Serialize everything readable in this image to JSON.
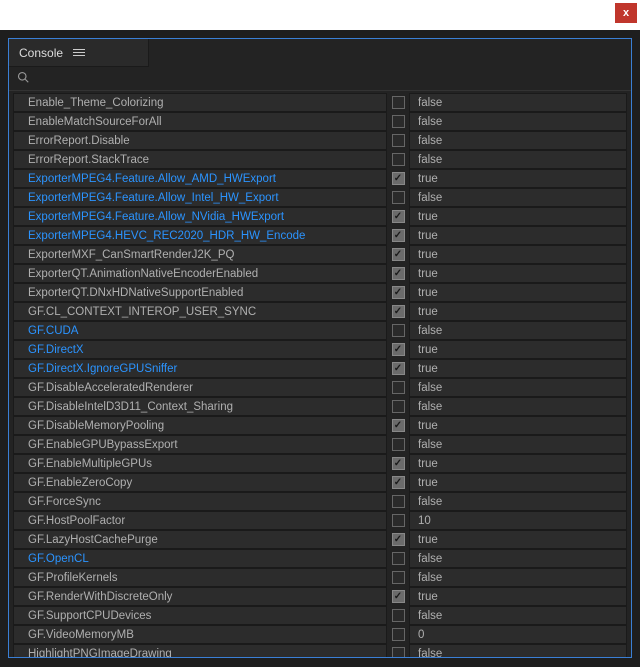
{
  "titlebar": {
    "close_label": "x"
  },
  "panel": {
    "title": "Console",
    "search_placeholder": ""
  },
  "rows": [
    {
      "name": "Enable_Theme_Colorizing",
      "checked": false,
      "value": "false",
      "highlight": false
    },
    {
      "name": "EnableMatchSourceForAll",
      "checked": false,
      "value": "false",
      "highlight": false
    },
    {
      "name": "ErrorReport.Disable",
      "checked": false,
      "value": "false",
      "highlight": false
    },
    {
      "name": "ErrorReport.StackTrace",
      "checked": false,
      "value": "false",
      "highlight": false
    },
    {
      "name": "ExporterMPEG4.Feature.Allow_AMD_HWExport",
      "checked": true,
      "value": "true",
      "highlight": true
    },
    {
      "name": "ExporterMPEG4.Feature.Allow_Intel_HW_Export",
      "checked": false,
      "value": "false",
      "highlight": true
    },
    {
      "name": "ExporterMPEG4.Feature.Allow_NVidia_HWExport",
      "checked": true,
      "value": "true",
      "highlight": true
    },
    {
      "name": "ExporterMPEG4.HEVC_REC2020_HDR_HW_Encode",
      "checked": true,
      "value": "true",
      "highlight": true
    },
    {
      "name": "ExporterMXF_CanSmartRenderJ2K_PQ",
      "checked": true,
      "value": "true",
      "highlight": false
    },
    {
      "name": "ExporterQT.AnimationNativeEncoderEnabled",
      "checked": true,
      "value": "true",
      "highlight": false
    },
    {
      "name": "ExporterQT.DNxHDNativeSupportEnabled",
      "checked": true,
      "value": "true",
      "highlight": false
    },
    {
      "name": "GF.CL_CONTEXT_INTEROP_USER_SYNC",
      "checked": true,
      "value": "true",
      "highlight": false
    },
    {
      "name": "GF.CUDA",
      "checked": false,
      "value": "false",
      "highlight": true
    },
    {
      "name": "GF.DirectX",
      "checked": true,
      "value": "true",
      "highlight": true
    },
    {
      "name": "GF.DirectX.IgnoreGPUSniffer",
      "checked": true,
      "value": "true",
      "highlight": true
    },
    {
      "name": "GF.DisableAcceleratedRenderer",
      "checked": false,
      "value": "false",
      "highlight": false
    },
    {
      "name": "GF.DisableIntelD3D11_Context_Sharing",
      "checked": false,
      "value": "false",
      "highlight": false
    },
    {
      "name": "GF.DisableMemoryPooling",
      "checked": true,
      "value": "true",
      "highlight": false
    },
    {
      "name": "GF.EnableGPUBypassExport",
      "checked": false,
      "value": "false",
      "highlight": false
    },
    {
      "name": "GF.EnableMultipleGPUs",
      "checked": true,
      "value": "true",
      "highlight": false
    },
    {
      "name": "GF.EnableZeroCopy",
      "checked": true,
      "value": "true",
      "highlight": false
    },
    {
      "name": "GF.ForceSync",
      "checked": false,
      "value": "false",
      "highlight": false
    },
    {
      "name": "GF.HostPoolFactor",
      "checked": false,
      "value": "10",
      "highlight": false
    },
    {
      "name": "GF.LazyHostCachePurge",
      "checked": true,
      "value": "true",
      "highlight": false
    },
    {
      "name": "GF.OpenCL",
      "checked": false,
      "value": "false",
      "highlight": true
    },
    {
      "name": "GF.ProfileKernels",
      "checked": false,
      "value": "false",
      "highlight": false
    },
    {
      "name": "GF.RenderWithDiscreteOnly",
      "checked": true,
      "value": "true",
      "highlight": false
    },
    {
      "name": "GF.SupportCPUDevices",
      "checked": false,
      "value": "false",
      "highlight": false
    },
    {
      "name": "GF.VideoMemoryMB",
      "checked": false,
      "value": "0",
      "highlight": false
    },
    {
      "name": "HighlightPNGImageDrawing",
      "checked": false,
      "value": "false",
      "highlight": false
    }
  ]
}
